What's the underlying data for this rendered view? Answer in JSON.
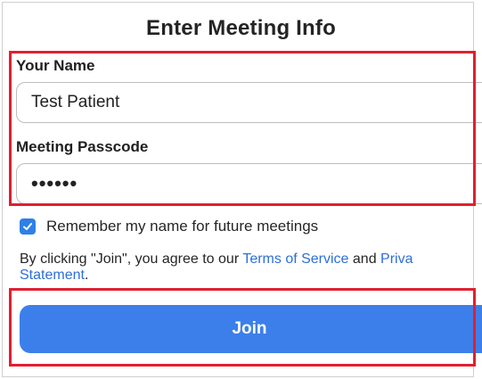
{
  "header": {
    "title": "Enter Meeting Info"
  },
  "form": {
    "name_label": "Your Name",
    "name_value": "Test Patient",
    "passcode_label": "Meeting Passcode",
    "passcode_value": "••••••",
    "remember_label": "Remember my name for future meetings",
    "remember_checked": true
  },
  "terms": {
    "prefix": "By clicking \"Join\", you agree to our ",
    "terms_link": "Terms of Service",
    "middle": " and ",
    "privacy_link_part1": "Priva",
    "privacy_link_part2": "Statement",
    "suffix": "."
  },
  "actions": {
    "join_label": "Join"
  },
  "colors": {
    "accent": "#3c7fea",
    "link": "#2d6fd6",
    "highlight": "#e0202f"
  }
}
